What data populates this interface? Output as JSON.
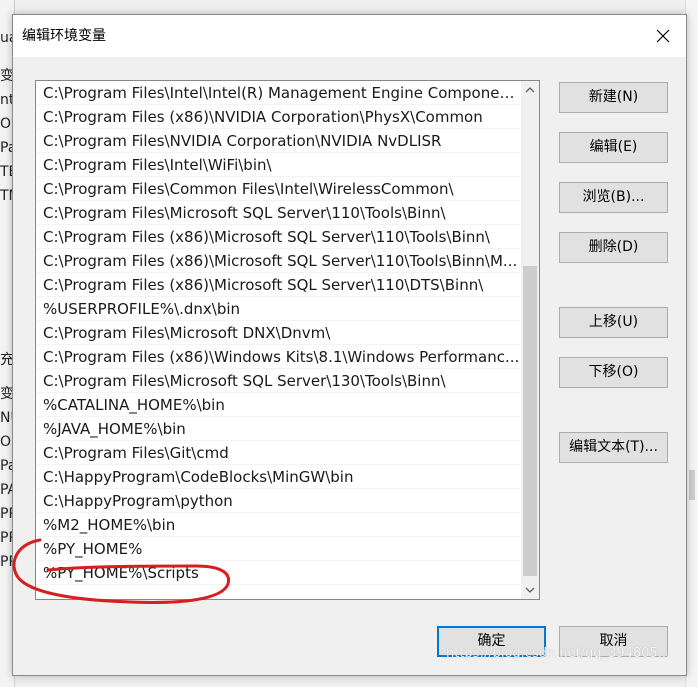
{
  "background": {
    "left_fragments": [
      "ua",
      "变",
      "nt",
      "Or",
      "Pa",
      "TE",
      "TM",
      "充",
      "变",
      "NU",
      "OS",
      "Pa",
      "PA",
      "PR",
      "PR",
      "PR"
    ]
  },
  "dialog": {
    "title": "编辑环境变量",
    "close_glyph": "✕"
  },
  "list": {
    "items": [
      "C:\\Program Files\\Intel\\Intel(R) Management Engine Componen...",
      "C:\\Program Files (x86)\\NVIDIA Corporation\\PhysX\\Common",
      "C:\\Program Files\\NVIDIA Corporation\\NVIDIA NvDLISR",
      "C:\\Program Files\\Intel\\WiFi\\bin\\",
      "C:\\Program Files\\Common Files\\Intel\\WirelessCommon\\",
      "C:\\Program Files\\Microsoft SQL Server\\110\\Tools\\Binn\\",
      "C:\\Program Files (x86)\\Microsoft SQL Server\\110\\Tools\\Binn\\",
      "C:\\Program Files (x86)\\Microsoft SQL Server\\110\\Tools\\Binn\\M...",
      "C:\\Program Files (x86)\\Microsoft SQL Server\\110\\DTS\\Binn\\",
      "%USERPROFILE%\\.dnx\\bin",
      "C:\\Program Files\\Microsoft DNX\\Dnvm\\",
      "C:\\Program Files (x86)\\Windows Kits\\8.1\\Windows Performanc...",
      "C:\\Program Files\\Microsoft SQL Server\\130\\Tools\\Binn\\",
      "%CATALINA_HOME%\\bin",
      "%JAVA_HOME%\\bin",
      "C:\\Program Files\\Git\\cmd",
      "C:\\HappyProgram\\CodeBlocks\\MinGW\\bin",
      "C:\\HappyProgram\\python",
      "%M2_HOME%\\bin",
      "%PY_HOME%",
      "%PY_HOME%\\Scripts"
    ],
    "scroll_up_glyph": "▲",
    "scroll_down_glyph": "▼"
  },
  "buttons": {
    "new": "新建(N)",
    "edit": "编辑(E)",
    "browse": "浏览(B)...",
    "delete": "删除(D)",
    "move_up": "上移(U)",
    "move_down": "下移(O)",
    "edit_text": "编辑文本(T)...",
    "ok": "确定",
    "cancel": "取消"
  },
  "annotation": {
    "color": "#d81e1e"
  },
  "watermark": "https://blog.csdn.net/qq_394805..."
}
